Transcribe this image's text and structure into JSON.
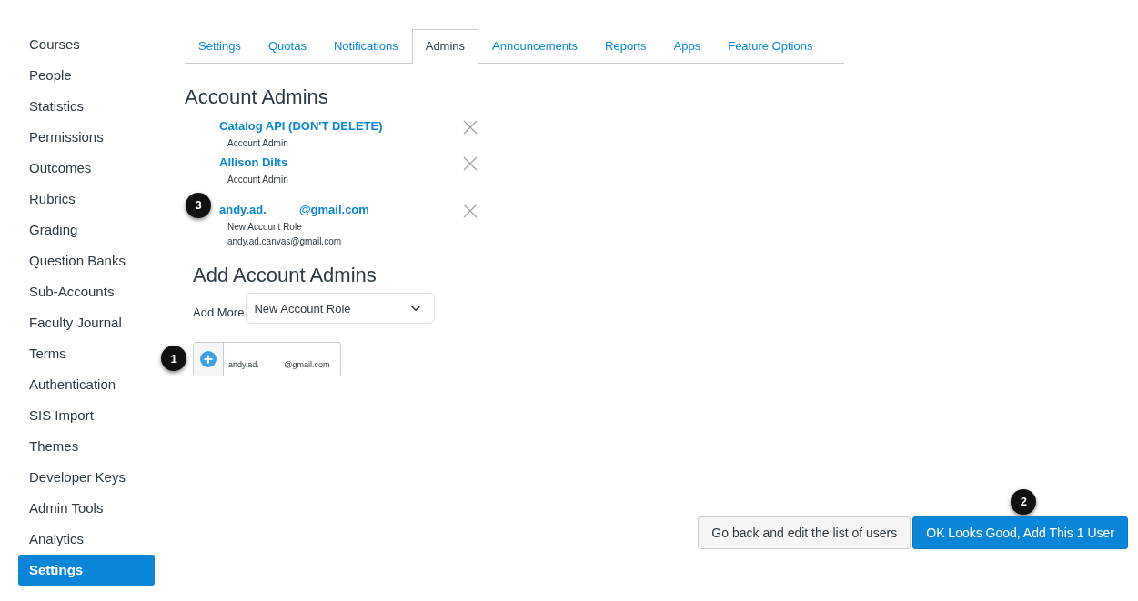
{
  "sidebar": {
    "items": [
      {
        "label": "Courses",
        "selected": false
      },
      {
        "label": "People",
        "selected": false
      },
      {
        "label": "Statistics",
        "selected": false
      },
      {
        "label": "Permissions",
        "selected": false
      },
      {
        "label": "Outcomes",
        "selected": false
      },
      {
        "label": "Rubrics",
        "selected": false
      },
      {
        "label": "Grading",
        "selected": false
      },
      {
        "label": "Question Banks",
        "selected": false
      },
      {
        "label": "Sub-Accounts",
        "selected": false
      },
      {
        "label": "Faculty Journal",
        "selected": false
      },
      {
        "label": "Terms",
        "selected": false
      },
      {
        "label": "Authentication",
        "selected": false
      },
      {
        "label": "SIS Import",
        "selected": false
      },
      {
        "label": "Themes",
        "selected": false
      },
      {
        "label": "Developer Keys",
        "selected": false
      },
      {
        "label": "Admin Tools",
        "selected": false
      },
      {
        "label": "Analytics",
        "selected": false
      },
      {
        "label": "Settings",
        "selected": true
      }
    ]
  },
  "tabs": [
    {
      "label": "Settings",
      "selected": false
    },
    {
      "label": "Quotas",
      "selected": false
    },
    {
      "label": "Notifications",
      "selected": false
    },
    {
      "label": "Admins",
      "selected": true
    },
    {
      "label": "Announcements",
      "selected": false
    },
    {
      "label": "Reports",
      "selected": false
    },
    {
      "label": "Apps",
      "selected": false
    },
    {
      "label": "Feature Options",
      "selected": false
    }
  ],
  "account_admins": {
    "heading": "Account Admins",
    "admins": [
      {
        "name": "Catalog API (DON'T DELETE)",
        "role": "Account Admin"
      },
      {
        "name": "Allison Dilts",
        "role": "Account Admin"
      },
      {
        "name": "andy.ad.          @gmail.com",
        "role": "New Account Role",
        "email": "andy.ad.canvas@gmail.com",
        "callout": "3"
      }
    ]
  },
  "add_admins": {
    "heading": "Add Account Admins",
    "add_more_label": "Add More",
    "role_select": "New Account Role",
    "user_entry": "andy.ad.           @gmail.com",
    "callout": "1"
  },
  "footer": {
    "buttons": [
      {
        "label": "Go back and edit the list of users",
        "kind": "secondary"
      },
      {
        "label": "OK Looks Good, Add This 1 User",
        "kind": "primary",
        "callout": "2"
      }
    ]
  }
}
